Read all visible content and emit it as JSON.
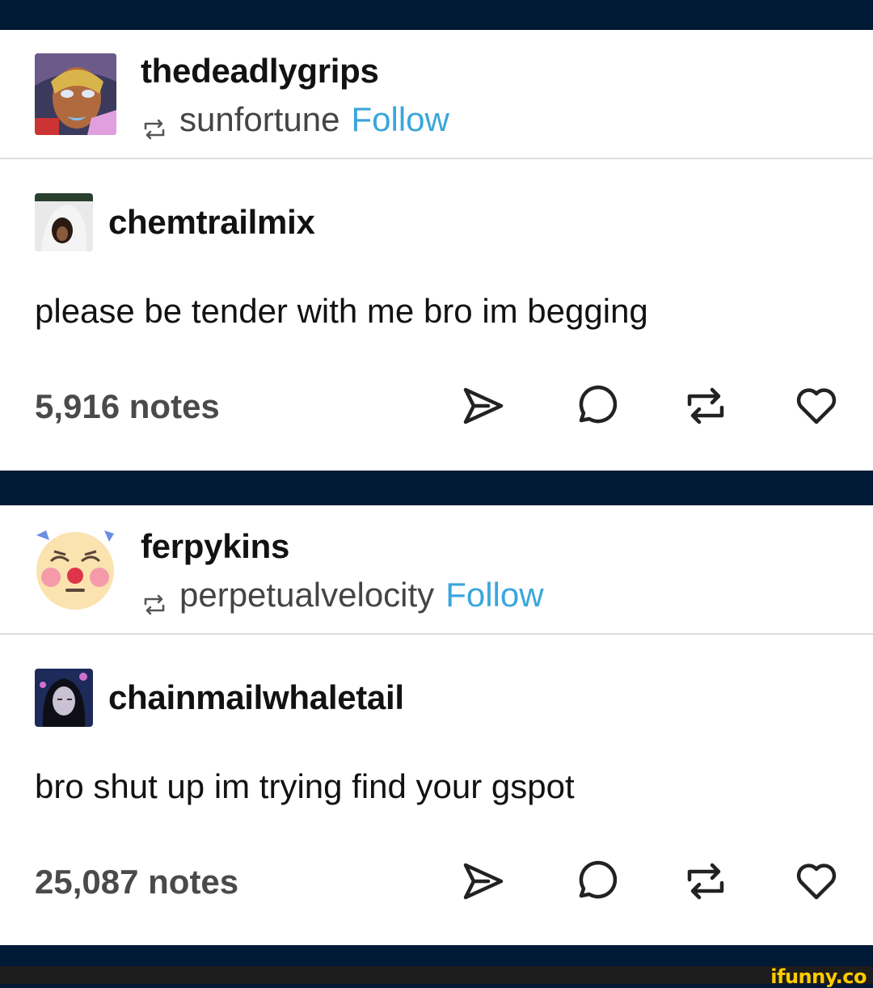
{
  "posts": [
    {
      "reblogger": "thedeadlygrips",
      "source": "sunfortune",
      "follow_label": "Follow",
      "original_author": "chemtrailmix",
      "text": "please be tender with me bro im begging",
      "notes": "5,916 notes"
    },
    {
      "reblogger": "ferpykins",
      "source": "perpetualvelocity",
      "follow_label": "Follow",
      "original_author": "chainmailwhaletail",
      "text": "bro shut up im trying find your gspot",
      "notes": "25,087 notes"
    }
  ],
  "actions": [
    "share-icon",
    "reply-icon",
    "reblog-icon",
    "like-icon"
  ],
  "colors": {
    "background": "#001935",
    "follow": "#3aa6dc",
    "watermark": "#ffcc00"
  },
  "watermark": "ifunny.co"
}
